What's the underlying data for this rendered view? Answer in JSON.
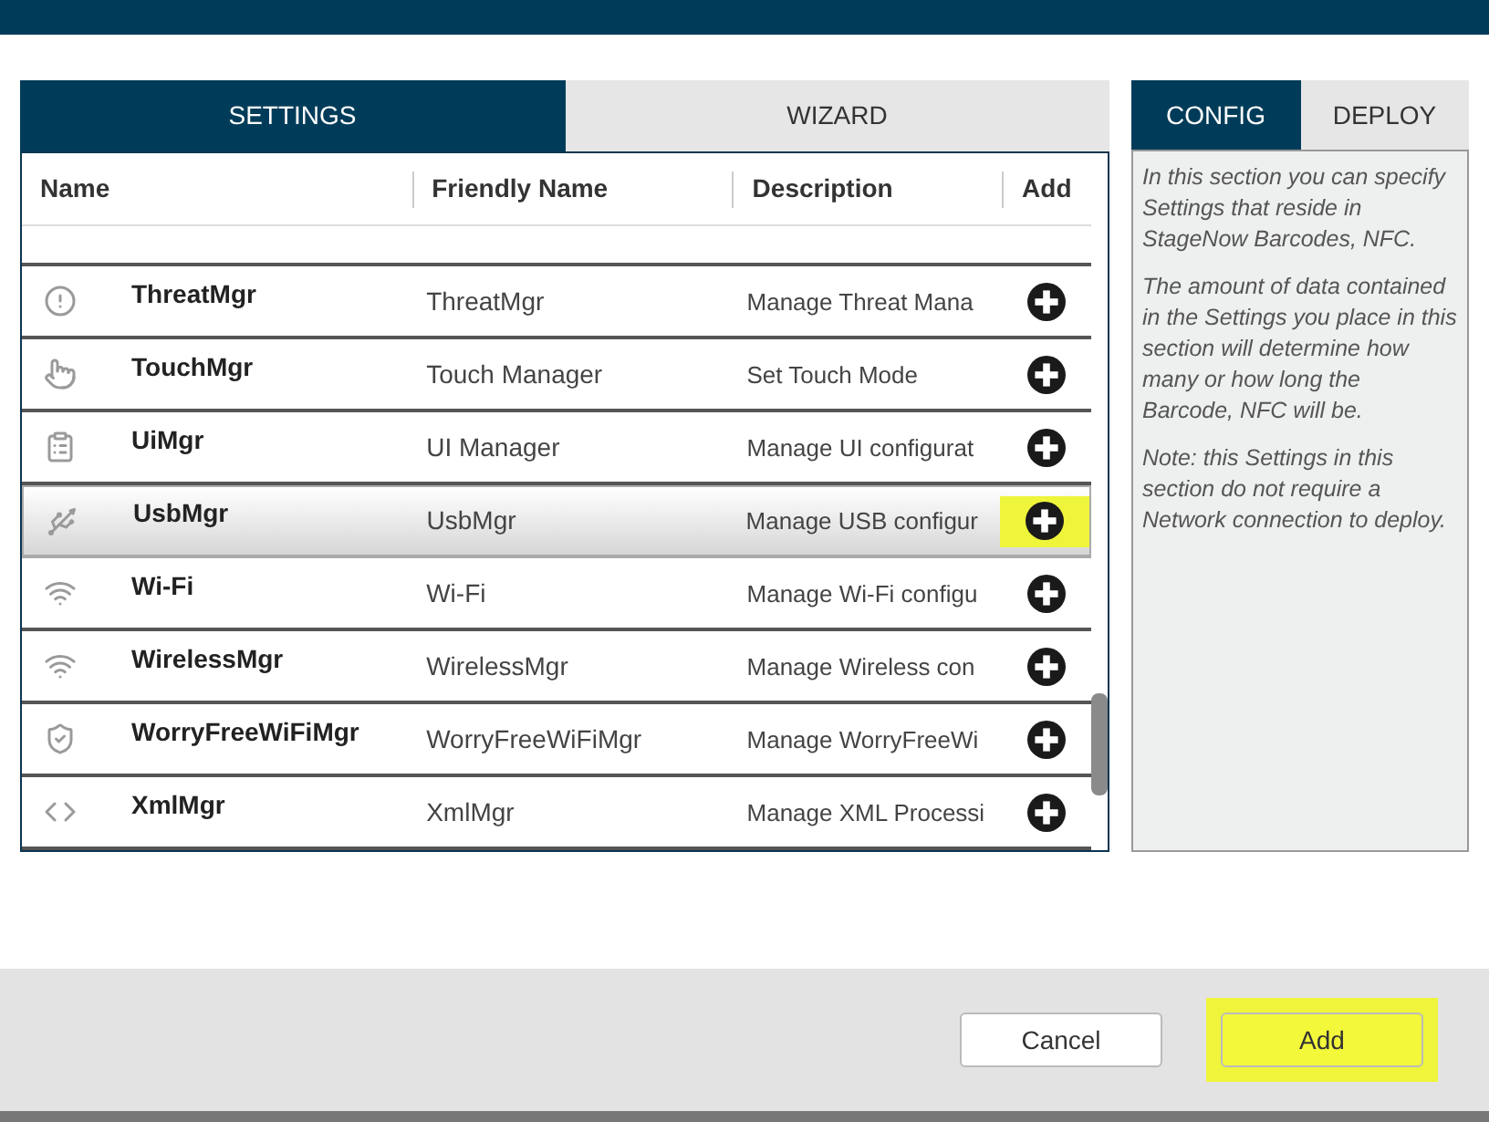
{
  "tabs": [
    {
      "label": "SETTINGS",
      "selected": true
    },
    {
      "label": "WIZARD",
      "selected": false
    }
  ],
  "table": {
    "columns": [
      "Name",
      "Friendly Name",
      "Description",
      "Add"
    ],
    "rows": [
      {
        "name": "ThreatMgr",
        "friendly_name": "ThreatMgr",
        "description": "Manage Threat Mana",
        "selected": false
      },
      {
        "name": "TouchMgr",
        "friendly_name": "Touch Manager",
        "description": "Set Touch Mode",
        "selected": false
      },
      {
        "name": "UiMgr",
        "friendly_name": "UI Manager",
        "description": "Manage UI configurat",
        "selected": false
      },
      {
        "name": "UsbMgr",
        "friendly_name": "UsbMgr",
        "description": "Manage USB configur",
        "selected": true
      },
      {
        "name": "Wi-Fi",
        "friendly_name": "Wi-Fi",
        "description": "Manage Wi-Fi configu",
        "selected": false
      },
      {
        "name": "WirelessMgr",
        "friendly_name": "WirelessMgr",
        "description": "Manage Wireless con",
        "selected": false
      },
      {
        "name": "WorryFreeWiFiMgr",
        "friendly_name": "WorryFreeWiFiMgr",
        "description": "Manage WorryFreeWi",
        "selected": false
      },
      {
        "name": "XmlMgr",
        "friendly_name": "XmlMgr",
        "description": "Manage XML Processi",
        "selected": false
      }
    ]
  },
  "side_tabs": [
    {
      "label": "CONFIG",
      "selected": true
    },
    {
      "label": "DEPLOY",
      "selected": false
    }
  ],
  "info": [
    "In this section you can specify Settings that reside in StageNow Barcodes, NFC.",
    "The amount of data contained in the Settings you place in this section will determine how many or how long the Barcode, NFC will be.",
    "Note: this Settings in this section do not require a Network connection to deploy."
  ],
  "buttons": [
    {
      "label": "Cancel",
      "highlighted": false
    },
    {
      "label": "Add",
      "highlighted": true
    }
  ]
}
